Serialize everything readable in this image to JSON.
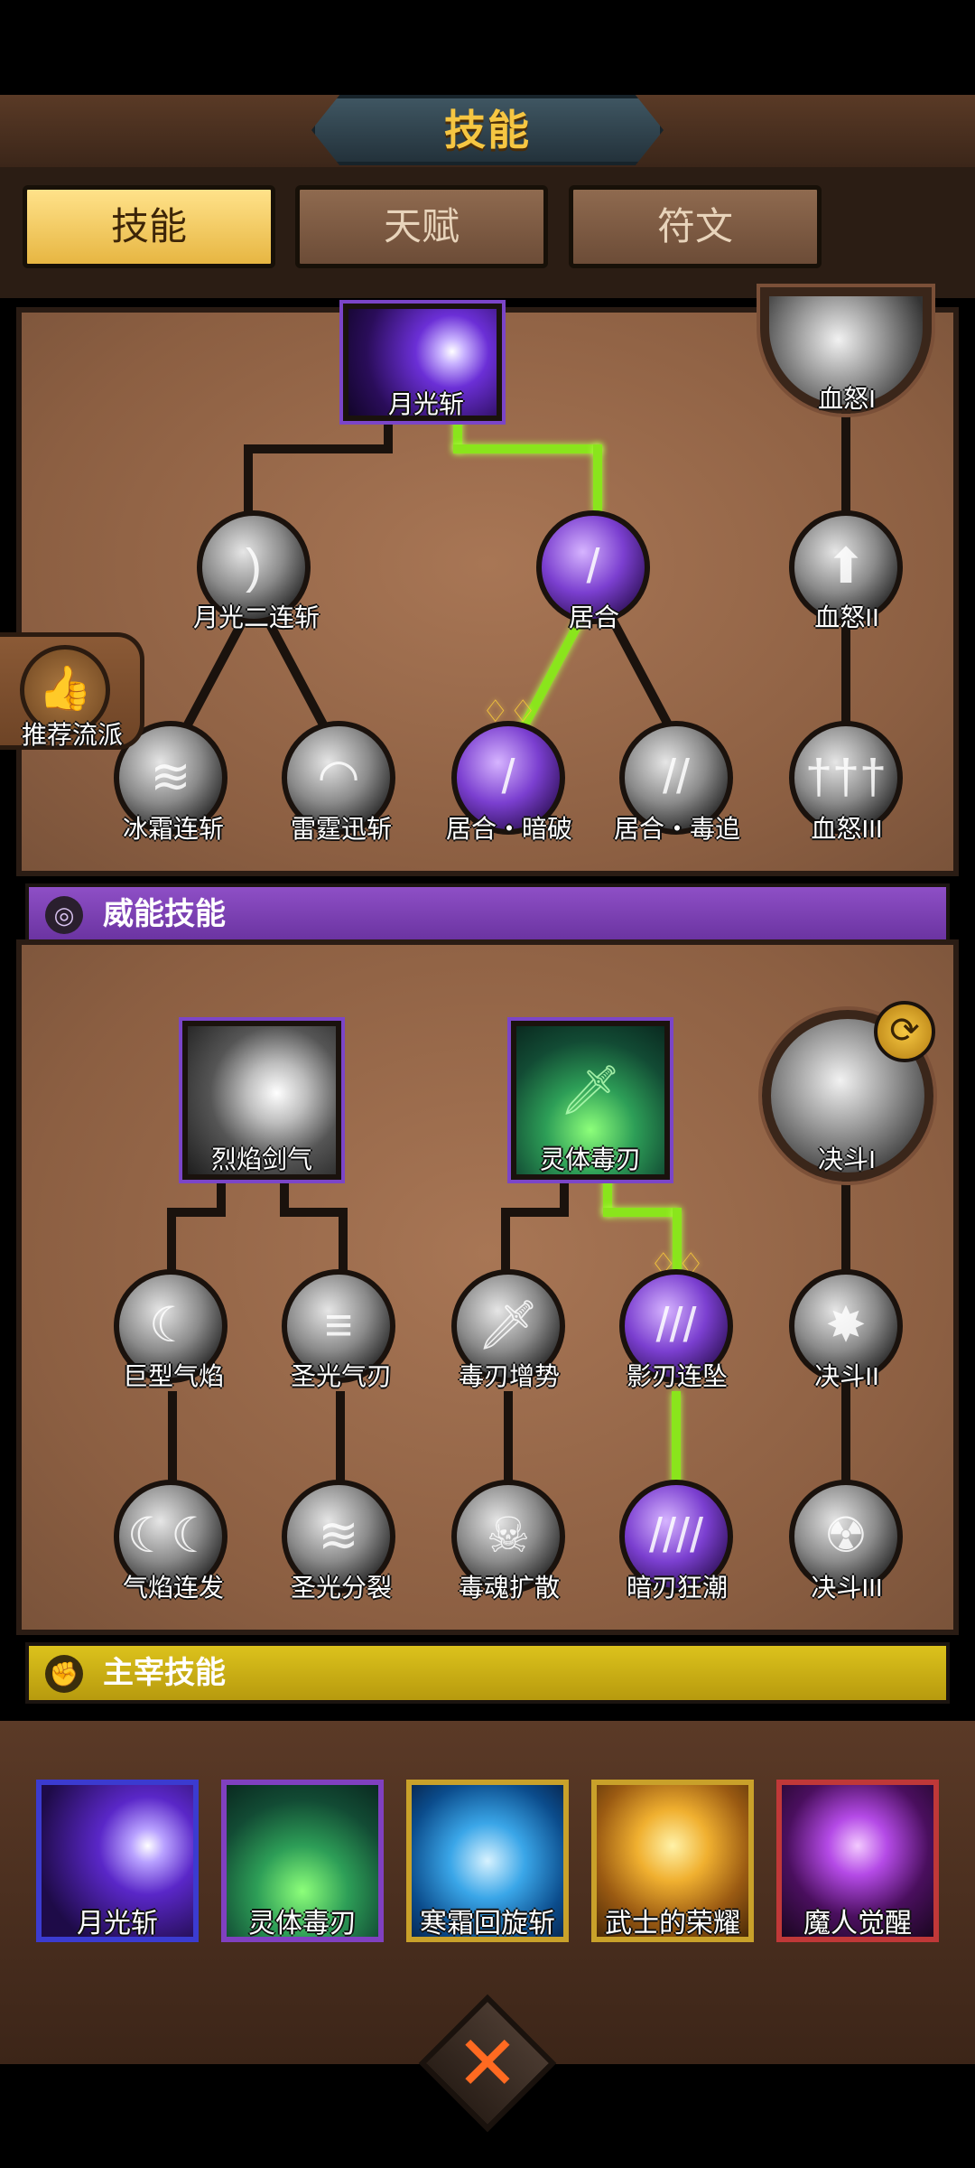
{
  "header": {
    "title": "技能"
  },
  "tabs": [
    {
      "label": "技能",
      "active": true
    },
    {
      "label": "天赋",
      "active": false
    },
    {
      "label": "符文",
      "active": false
    }
  ],
  "recommend": {
    "label": "推荐流派"
  },
  "tree_top": {
    "root": "月光斩",
    "nodes": {
      "moon_double": "月光二连斩",
      "iai": "居合",
      "frost": "冰霜连斩",
      "thunder": "雷霆迅斩",
      "iai_dark": "居合・暗破",
      "iai_poison": "居合・毒追",
      "rage1": "血怒I",
      "rage2": "血怒II",
      "rage3": "血怒III"
    }
  },
  "power_section": {
    "label": "威能技能",
    "nodes": {
      "flame_sword": "烈焰剑气",
      "spirit_blade": "灵体毒刃",
      "duel1": "决斗I",
      "giant_flame": "巨型气焰",
      "holy_blade": "圣光气刃",
      "poison_surge": "毒刃增势",
      "shadow_fall": "影刃连坠",
      "duel2": "决斗II",
      "flame_burst": "气焰连发",
      "holy_split": "圣光分裂",
      "soul_spread": "毒魂扩散",
      "dark_tide": "暗刃狂潮",
      "duel3": "决斗III"
    }
  },
  "master_section": {
    "label": "主宰技能"
  },
  "equipped": [
    {
      "label": "月光斩",
      "border": "#6a4cff"
    },
    {
      "label": "灵体毒刃",
      "border": "#9a52d8"
    },
    {
      "label": "寒霜回旋斩",
      "border": "#e0b93a"
    },
    {
      "label": "武士的荣耀",
      "border": "#e0b93a"
    },
    {
      "label": "魔人觉醒",
      "border": "#e04a4a"
    }
  ],
  "close": {
    "glyph": "✕"
  },
  "colors": {
    "accent_gold": "#f6c642",
    "path_green": "#8ae51c",
    "power_purple": "#7b3fd0",
    "master_gold": "#d4b817"
  }
}
